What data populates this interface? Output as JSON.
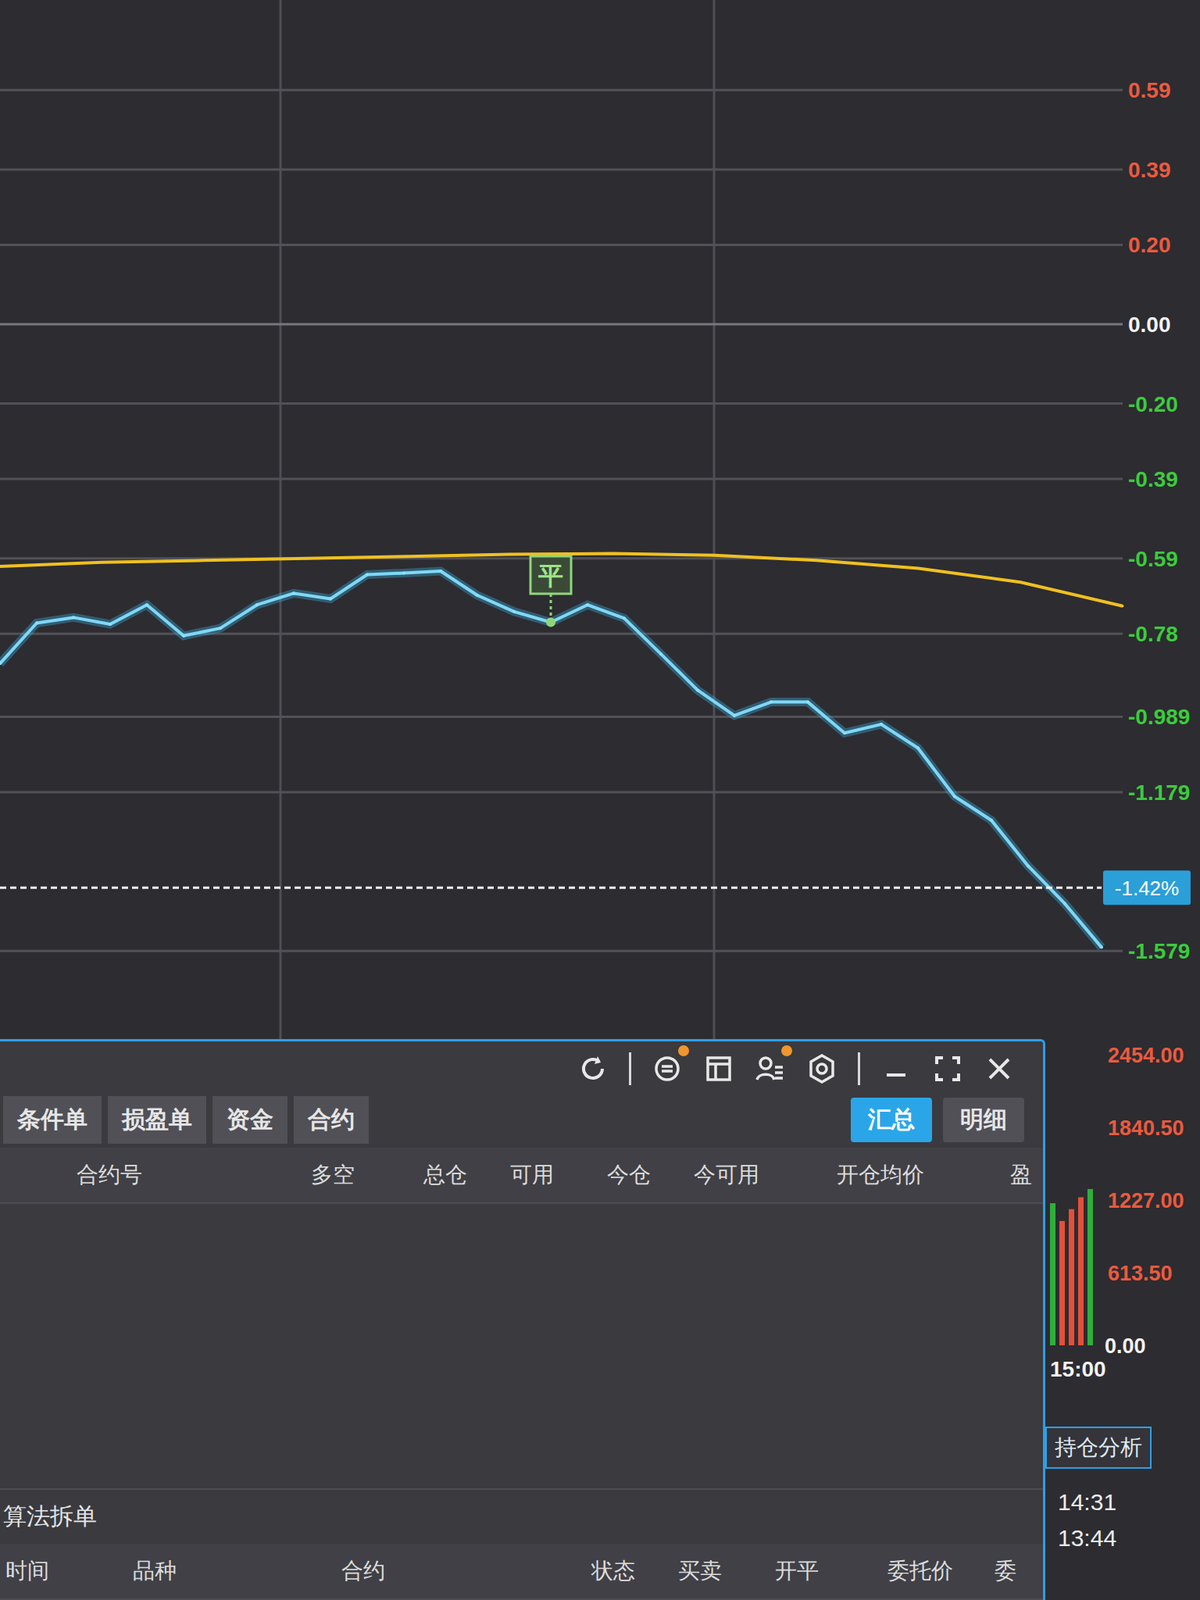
{
  "chart": {
    "ticks": [
      "0.59",
      "0.39",
      "0.20",
      "0.00",
      "-0.20",
      "-0.39",
      "-0.59",
      "-0.78",
      "-0.989",
      "-1.179",
      "-1.579"
    ],
    "price_series": [
      -0.855,
      -0.753,
      -0.739,
      -0.756,
      -0.707,
      -0.785,
      -0.766,
      -0.707,
      -0.678,
      -0.692,
      -0.631,
      -0.627,
      -0.622,
      -0.683,
      -0.724,
      -0.751,
      -0.707,
      -0.741,
      -0.831,
      -0.922,
      -0.986,
      -0.952,
      -0.952,
      -1.03,
      -1.008,
      -1.068,
      -1.19,
      -1.25,
      -1.365,
      -1.46,
      -1.57
    ],
    "average_series": [
      -0.61,
      -0.6,
      -0.595,
      -0.59,
      -0.585,
      -0.58,
      -0.578,
      -0.582,
      -0.595,
      -0.615,
      -0.65,
      -0.71
    ],
    "trade_marker": {
      "label": "平",
      "index": 15
    },
    "reference_line": {
      "value": -1.42,
      "badge": "-1.42%"
    }
  },
  "volume": {
    "ticks": [
      "2454.00",
      "1840.50",
      "1227.00",
      "613.50",
      "0.00"
    ],
    "time": "15:00",
    "bars": [
      {
        "value": 1200,
        "color": "#2fae3a"
      },
      {
        "value": 1050,
        "color": "#e2503a"
      },
      {
        "value": 1150,
        "color": "#e2503a"
      },
      {
        "value": 1250,
        "color": "#e2503a"
      },
      {
        "value": 1320,
        "color": "#2fae3a"
      }
    ]
  },
  "panel": {
    "toolbar": [
      {
        "kind": "refresh",
        "badge": false
      },
      {
        "kind": "notice",
        "badge": true
      },
      {
        "kind": "layout",
        "badge": false
      },
      {
        "kind": "users",
        "badge": true
      },
      {
        "kind": "settings",
        "badge": false
      }
    ],
    "tabs": [
      {
        "label": "条件单",
        "selected": false
      },
      {
        "label": "损盈单",
        "selected": false
      },
      {
        "label": "资金",
        "selected": false
      },
      {
        "label": "合约",
        "selected": false
      }
    ],
    "views": [
      {
        "label": "汇总",
        "selected": true
      },
      {
        "label": "明细",
        "selected": false
      }
    ],
    "columns": [
      "合约号",
      "多空",
      "总仓",
      "可用",
      "今仓",
      "今可用",
      "开仓均价",
      "盈"
    ],
    "section": "算法拆单",
    "order_columns": [
      "时间",
      "品种",
      "合约",
      "状态",
      "买卖",
      "开平",
      "委托价",
      "委"
    ]
  },
  "side": {
    "button": "持仓分析",
    "times": [
      "14:31",
      "13:44"
    ]
  }
}
